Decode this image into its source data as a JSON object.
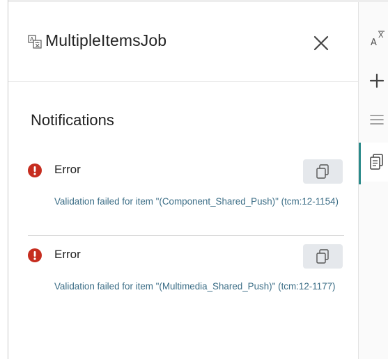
{
  "panel": {
    "title": "MultipleItemsJob",
    "section_title": "Notifications"
  },
  "notifications": [
    {
      "severity": "Error",
      "message": "Validation failed for item \"(Component_Shared_Push)\" (tcm:12-1154)"
    },
    {
      "severity": "Error",
      "message": "Validation failed for item \"(Multimedia_Shared_Push)\" (tcm:12-1177)"
    }
  ],
  "colors": {
    "error": "#c62d1f",
    "message_text": "#3b6d86",
    "active_accent": "#2b8a8a",
    "copy_button_bg": "#e5e8ec"
  },
  "icons": {
    "job": "translation-job-icon",
    "close": "close-icon",
    "error": "error-icon",
    "copy": "copy-icon",
    "sidebar": [
      "translate-icon",
      "add-icon",
      "menu-icon",
      "notifications-clipboard-icon"
    ]
  }
}
